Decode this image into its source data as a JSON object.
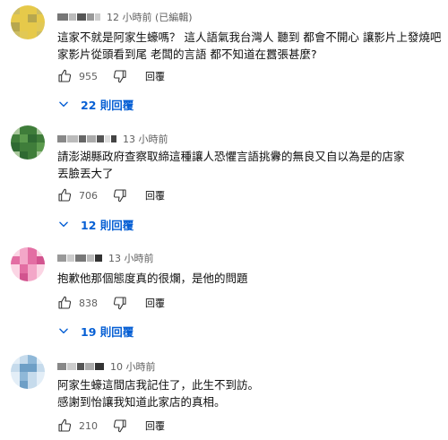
{
  "comments": [
    {
      "time": "12 小時前 (已編輯)",
      "lines": [
        "這家不就是阿家生蠔嗎？ 這人語氣我台灣人 聽到 都會不開心  讓影片上發燒吧",
        "家影片從頭看到尾 老闆的言語 都不知道在囂張甚麼?"
      ],
      "likes": "955",
      "reply_label": "回覆",
      "replies_label": "22 則回覆",
      "avatar_colors": [
        "#cdbd63",
        "#e6c94a",
        "#b7a74e",
        "#e1c855"
      ]
    },
    {
      "time": "13 小時前",
      "lines": [
        "請澎湖縣政府查察取締這種讓人恐懼言語挑釁的無良又自以為是的店家",
        "丟臉丟大了"
      ],
      "likes": "706",
      "reply_label": "回覆",
      "replies_label": "12 則回覆",
      "avatar_colors": [
        "#3f7d3a",
        "#5b9a4d",
        "#2f6a32",
        "#a8c79b"
      ]
    },
    {
      "time": "13 小時前",
      "lines": [
        "抱歉他那個態度真的很爛，是他的問題"
      ],
      "likes": "838",
      "reply_label": "回覆",
      "replies_label": "19 則回覆",
      "avatar_colors": [
        "#e36ea3",
        "#f3a7c8",
        "#d2548f",
        "#fbd5e4"
      ]
    },
    {
      "time": "10 小時前",
      "lines": [
        "阿家生蠔這間店我記住了，此生不到訪。",
        "感謝到怡讓我知道此家店的真相。"
      ],
      "likes": "210",
      "reply_label": "回覆",
      "replies_label": "",
      "avatar_colors": [
        "#8fb8d8",
        "#c6dbec",
        "#6e9fc6",
        "#e3eef7"
      ]
    }
  ],
  "colors": {
    "link_blue": "#065fd4",
    "meta_gray": "#606060",
    "text": "#0f0f0f"
  },
  "icons": {
    "like": "thumbs-up-outline",
    "dislike": "thumbs-down-outline",
    "expand": "chevron-down"
  }
}
